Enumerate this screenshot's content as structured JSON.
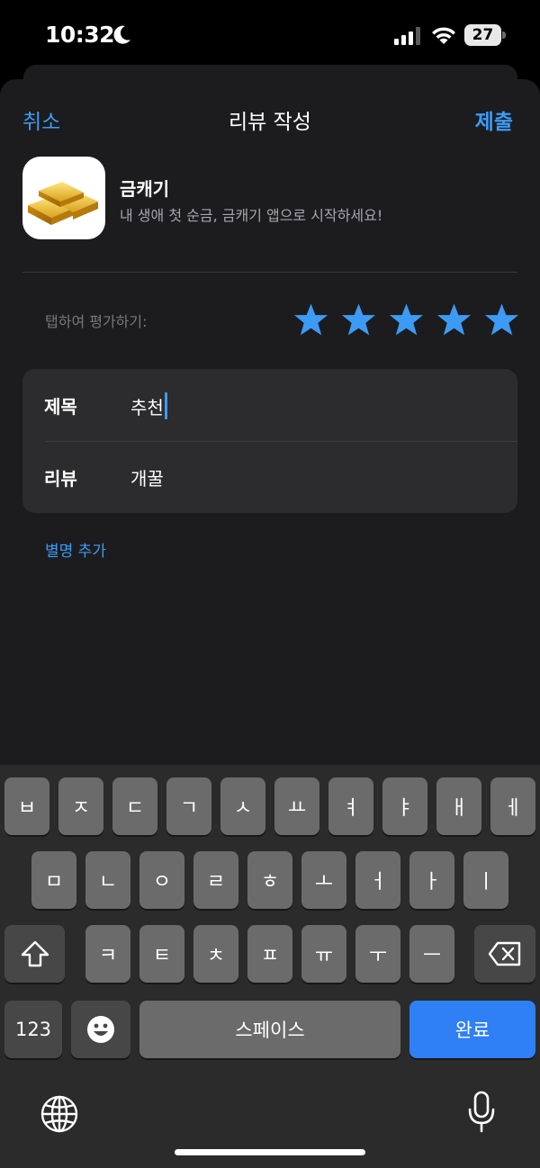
{
  "status_bar": {
    "time": "10:32",
    "battery": "27"
  },
  "nav": {
    "cancel": "취소",
    "title": "리뷰 작성",
    "submit": "제출"
  },
  "app": {
    "name": "금캐기",
    "subtitle": "내 생애 첫 순금, 금캐기 앱으로 시작하세요!",
    "icon": "gold-bars-icon"
  },
  "rating": {
    "label": "탭하여 평가하기:",
    "stars": 5,
    "max": 5,
    "color": "#3d9bf5"
  },
  "form": {
    "title_label": "제목",
    "title_value": "추천",
    "review_label": "리뷰",
    "review_value": "개꿀"
  },
  "nickname_link": "별명 추가",
  "keyboard": {
    "row1": [
      "ㅂ",
      "ㅈ",
      "ㄷ",
      "ㄱ",
      "ㅅ",
      "ㅛ",
      "ㅕ",
      "ㅑ",
      "ㅐ",
      "ㅔ"
    ],
    "row2": [
      "ㅁ",
      "ㄴ",
      "ㅇ",
      "ㄹ",
      "ㅎ",
      "ㅗ",
      "ㅓ",
      "ㅏ",
      "ㅣ"
    ],
    "row3": [
      "ㅋ",
      "ㅌ",
      "ㅊ",
      "ㅍ",
      "ㅠ",
      "ㅜ",
      "ㅡ"
    ],
    "numbers": "123",
    "space": "스페이스",
    "done": "완료",
    "accent": "#2f7ff5"
  }
}
